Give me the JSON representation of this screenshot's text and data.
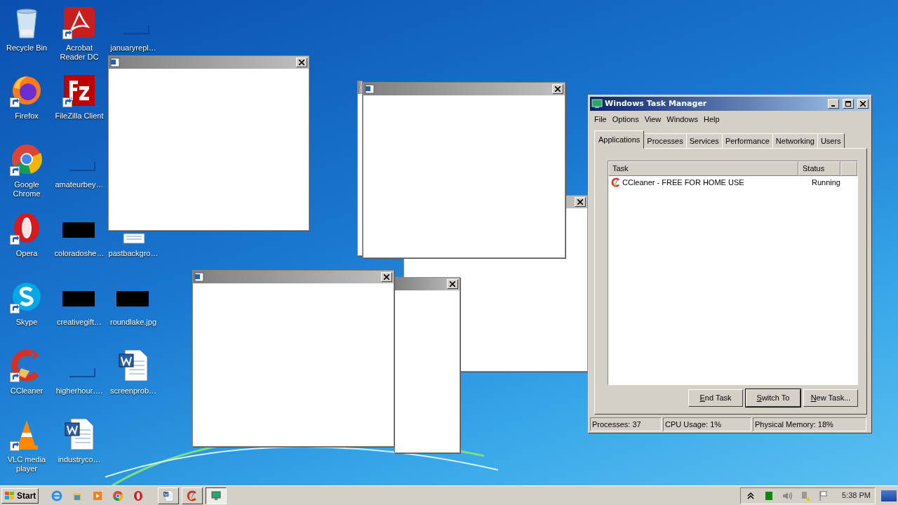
{
  "desktop_icons": [
    {
      "label": "Recycle Bin",
      "kind": "recycle-bin",
      "shortcut": false
    },
    {
      "label": "Firefox",
      "kind": "firefox",
      "shortcut": true
    },
    {
      "label": "Google Chrome",
      "kind": "chrome",
      "shortcut": true
    },
    {
      "label": "Opera",
      "kind": "opera",
      "shortcut": true
    },
    {
      "label": "Skype",
      "kind": "skype",
      "shortcut": true
    },
    {
      "label": "CCleaner",
      "kind": "ccleaner",
      "shortcut": true
    },
    {
      "label": "VLC media player",
      "kind": "vlc",
      "shortcut": true
    },
    {
      "label": "Acrobat Reader DC",
      "kind": "acrobat",
      "shortcut": true
    },
    {
      "label": "FileZilla Client",
      "kind": "filezilla",
      "shortcut": true
    },
    {
      "label": "amateurbey…",
      "kind": "blank-thumb",
      "shortcut": false
    },
    {
      "label": "coloradoshe…",
      "kind": "dark-thumb",
      "shortcut": false
    },
    {
      "label": "creativegift…",
      "kind": "dark-thumb",
      "shortcut": false
    },
    {
      "label": "higherhour….",
      "kind": "blank-thumb",
      "shortcut": false
    },
    {
      "label": "industryco…",
      "kind": "word-doc",
      "shortcut": false
    },
    {
      "label": "januaryrepl…",
      "kind": "blank-thumb",
      "shortcut": false
    },
    {
      "label": "pastbackgro…",
      "kind": "doc-partial",
      "shortcut": false
    },
    {
      "label": "roundlake.jpg",
      "kind": "dark-thumb",
      "shortcut": false
    },
    {
      "label": "screenprob…",
      "kind": "word-doc",
      "shortcut": false
    }
  ],
  "task_manager": {
    "title": "Windows Task Manager",
    "menu": [
      "File",
      "Options",
      "View",
      "Windows",
      "Help"
    ],
    "tabs": [
      {
        "label": "Applications",
        "selected": true
      },
      {
        "label": "Processes",
        "selected": false
      },
      {
        "label": "Services",
        "selected": false
      },
      {
        "label": "Performance",
        "selected": false
      },
      {
        "label": "Networking",
        "selected": false
      },
      {
        "label": "Users",
        "selected": false
      }
    ],
    "columns": [
      "Task",
      "Status"
    ],
    "rows": [
      {
        "task": "CCleaner - FREE FOR HOME USE",
        "status": "Running"
      }
    ],
    "buttons": [
      {
        "label": "End Task",
        "default": false
      },
      {
        "label": "Switch To",
        "default": true
      },
      {
        "label": "New Task...",
        "default": false
      }
    ],
    "status_bar": [
      "Processes: 37",
      "CPU Usage: 1%",
      "Physical Memory: 18%"
    ]
  },
  "taskbar": {
    "start": "Start",
    "quick_launch": [
      {
        "kind": "ie"
      },
      {
        "kind": "explorer"
      },
      {
        "kind": "media-player"
      },
      {
        "kind": "chrome"
      },
      {
        "kind": "opera"
      }
    ],
    "tasks": [
      {
        "kind": "word",
        "selected": false
      },
      {
        "kind": "ccleaner",
        "selected": false
      },
      {
        "kind": "task-manager",
        "selected": true
      }
    ],
    "tray": [
      {
        "kind": "chevron"
      },
      {
        "kind": "green-square"
      },
      {
        "kind": "speaker"
      },
      {
        "kind": "network-warning"
      },
      {
        "kind": "flag"
      }
    ],
    "clock": "5:38 PM"
  }
}
